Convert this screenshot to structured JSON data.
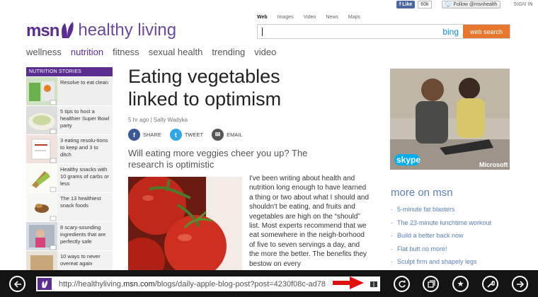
{
  "social": {
    "fb_like": "Like",
    "fb_count": "60k",
    "tw_follow": "Follow @msnhealth",
    "signin": "SIGN IN"
  },
  "logo": {
    "brand": "msn",
    "section": "healthy living"
  },
  "nav": [
    "wellness",
    "nutrition",
    "fitness",
    "sexual health",
    "trending",
    "video"
  ],
  "search": {
    "tabs": [
      "Web",
      "Images",
      "Video",
      "News",
      "Maps"
    ],
    "value": "",
    "engine": "bing",
    "button": "web search"
  },
  "stories": {
    "heading": "NUTRITION STORIES",
    "items": [
      {
        "label": "Resolve to eat clean"
      },
      {
        "label": "5 tips to host a healthier Super Bowl party"
      },
      {
        "label": "3 eating resolu-tions to keep and 3 to ditch"
      },
      {
        "label": "Healthy snacks with 10 grams of carbs or less"
      },
      {
        "label": "The 13 healthiest snack foods"
      },
      {
        "label": "8 scary-sounding ingredients that are perfectly safe"
      },
      {
        "label": "10 ways to never overeat again"
      }
    ]
  },
  "article": {
    "headline": "Eating vegetables linked to optimism",
    "time": "5 hr ago",
    "author": "Sally Wadyka",
    "share": {
      "share": "SHARE",
      "tweet": "TWEET",
      "email": "EMAIL"
    },
    "deck": "Will eating more veggies cheer you up? The research is optimistic",
    "body": "I've been writing about health and nutrition long enough to have learned a thing or two about what I should and shouldn't be eating, and fruits and vegetables are high on the “should” list. Most experts recommend that we eat somewhere in the neigh-borhood of five to seven servings a day, and the more the better. The benefits they bestow on every"
  },
  "ad": {
    "brand": "skype",
    "maker": "Microsoft"
  },
  "more": {
    "heading": "more on msn",
    "items": [
      "5-minute fat blasters",
      "The 23-minute lunchtime workout",
      "Build a better back now",
      "Flat butt no more!",
      "Sculpt firm and shapely legs"
    ]
  },
  "appbar": {
    "url_prefix": "http://healthyliving.",
    "url_domain": "msn.com",
    "url_rest": "/blogs/daily-apple-blog-post?post=4230f08c-ad78"
  },
  "colors": {
    "brand": "#5c2d91",
    "search_button": "#e8762d",
    "links": "#5a7fb8",
    "appbar": "#141414"
  }
}
